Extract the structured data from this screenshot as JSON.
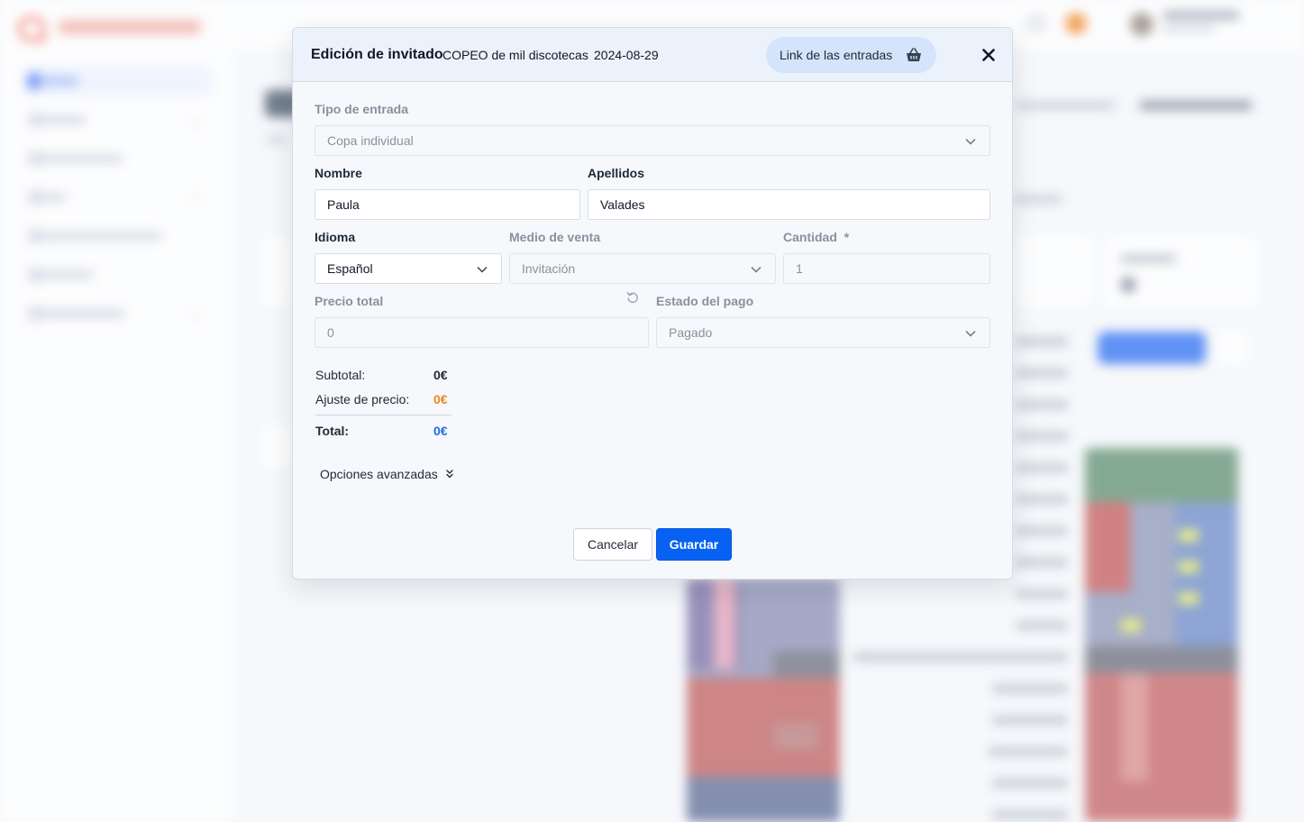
{
  "modal": {
    "title": "Edición de invitado",
    "event_name": "COPEO de mil discotecas",
    "event_date": "2024-08-29",
    "link_button_label": "Link de las entradas",
    "link_button_icon": "basket-icon",
    "close_icon": "close-icon"
  },
  "form": {
    "ticket_type": {
      "label": "Tipo de entrada",
      "value": "Copa individual",
      "disabled": true
    },
    "first_name": {
      "label": "Nombre",
      "value": "Paula"
    },
    "last_name": {
      "label": "Apellidos",
      "value": "Valades"
    },
    "language": {
      "label": "Idioma",
      "value": "Español"
    },
    "sales_channel": {
      "label": "Medio de venta",
      "value": "Invitación",
      "disabled": true
    },
    "quantity": {
      "label": "Cantidad",
      "required_mark": "*",
      "value": "1",
      "disabled": true
    },
    "total_price": {
      "label": "Precio total",
      "value": "0",
      "reset_icon": "reset-icon",
      "disabled": true
    },
    "payment_status": {
      "label": "Estado del pago",
      "value": "Pagado",
      "disabled": true
    }
  },
  "summary": {
    "subtotal_label": "Subtotal:",
    "subtotal_value": "0€",
    "adjustment_label": "Ajuste de precio:",
    "adjustment_value": "0€",
    "total_label": "Total:",
    "total_value": "0€"
  },
  "advanced_options_label": "Opciones avanzadas",
  "actions": {
    "cancel": "Cancelar",
    "save": "Guardar"
  },
  "colors": {
    "primary": "#0762f4",
    "adjustment": "#e8891a",
    "total": "#1f6fe0",
    "header_bg": "#ecf2fb"
  }
}
